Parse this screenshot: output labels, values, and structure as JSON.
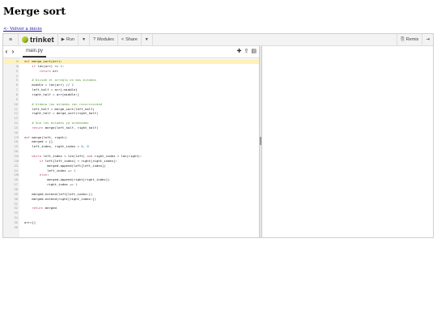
{
  "page": {
    "title": "Merge sort",
    "back_link": "<- Volver a inicio"
  },
  "toolbar": {
    "brand": "trinket",
    "run_label": "Run",
    "modules_label": "Modules",
    "share_label": "Share",
    "remix_label": "Remix",
    "icons": [
      "menu-icon",
      "play-icon",
      "question-icon",
      "share-icon",
      "chevron-down-icon",
      "remix-icon",
      "sign-in-icon"
    ]
  },
  "editor": {
    "file_tab": "main.py",
    "tab_icons": [
      "add-file-icon",
      "upload-icon",
      "download-icon"
    ],
    "lines": [
      {
        "n": "1",
        "t": "def merge_sort(arr):"
      },
      {
        "n": "2",
        "t": "    if len(arr) <= 1:"
      },
      {
        "n": "3",
        "t": "        return arr"
      },
      {
        "n": "4",
        "t": ""
      },
      {
        "n": "5",
        "t": "    # Divide el arreglo en dos mitades"
      },
      {
        "n": "6",
        "t": "    middle = len(arr) // 2"
      },
      {
        "n": "7",
        "t": "    left_half = arr[:middle]"
      },
      {
        "n": "8",
        "t": "    right_half = arr[middle:]"
      },
      {
        "n": "9",
        "t": ""
      },
      {
        "n": "10",
        "t": "    # Ordena las mitades con recursividad"
      },
      {
        "n": "11",
        "t": "    left_half = merge_sort(left_half)"
      },
      {
        "n": "12",
        "t": "    right_half = merge_sort(right_half)"
      },
      {
        "n": "13",
        "t": ""
      },
      {
        "n": "14",
        "t": "    # Une las mitades ya ordenadas"
      },
      {
        "n": "15",
        "t": "    return merge(left_half, right_half)"
      },
      {
        "n": "16",
        "t": ""
      },
      {
        "n": "17",
        "t": "def merge(left, right):"
      },
      {
        "n": "18",
        "t": "    merged = []"
      },
      {
        "n": "19",
        "t": "    left_index, right_index = 0, 0"
      },
      {
        "n": "20",
        "t": ""
      },
      {
        "n": "21",
        "t": "    while left_index < len(left) and right_index < len(right):"
      },
      {
        "n": "22",
        "t": "        if left[left_index] < right[right_index]:"
      },
      {
        "n": "23",
        "t": "            merged.append(left[left_index])"
      },
      {
        "n": "24",
        "t": "            left_index += 1"
      },
      {
        "n": "25",
        "t": "        else:"
      },
      {
        "n": "26",
        "t": "            merged.append(right[right_index])"
      },
      {
        "n": "27",
        "t": "            right_index += 1"
      },
      {
        "n": "28",
        "t": ""
      },
      {
        "n": "29",
        "t": "    merged.extend(left[left_index:])"
      },
      {
        "n": "30",
        "t": "    merged.extend(right[right_index:])"
      },
      {
        "n": "31",
        "t": ""
      },
      {
        "n": "32",
        "t": "    return merged"
      },
      {
        "n": "33",
        "t": ""
      },
      {
        "n": "34",
        "t": ""
      },
      {
        "n": "35",
        "t": "arr=[]"
      },
      {
        "n": "36",
        "t": ""
      }
    ]
  },
  "colors": {
    "keyword": "#b5427a",
    "comment": "#5a9a3c",
    "number": "#1a6fb5",
    "current_line": "#fff2b8"
  }
}
